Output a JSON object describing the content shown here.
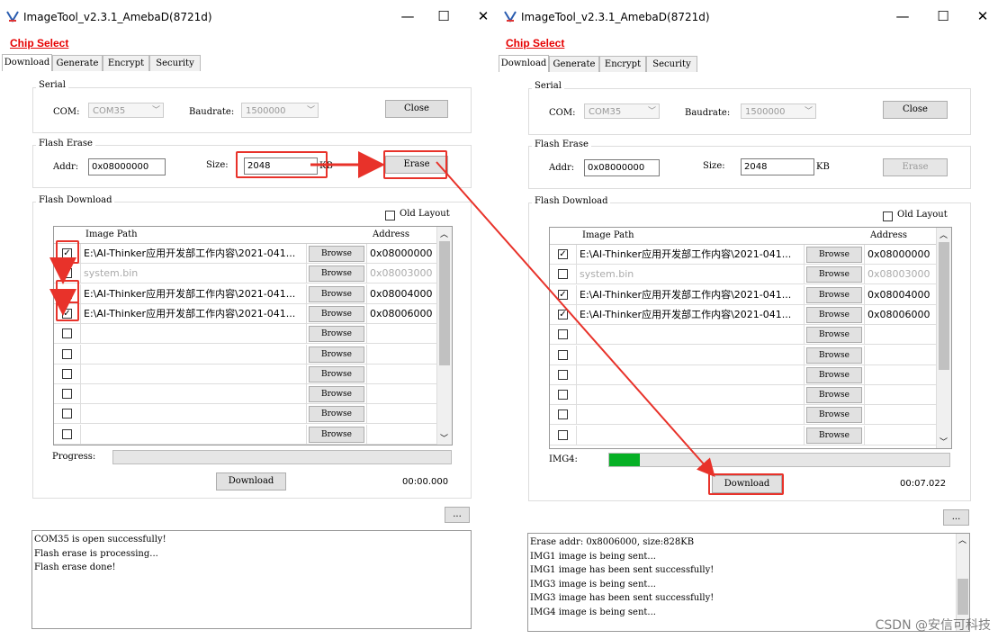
{
  "window_left": {
    "title": "ImageTool_v2.3.1_AmebaD(8721d)",
    "chip_select": "Chip Select",
    "tabs": [
      "Download",
      "Generate",
      "Encrypt",
      "Security"
    ],
    "serial": {
      "group": "Serial",
      "com_label": "COM:",
      "com_value": "COM35",
      "baud_label": "Baudrate:",
      "baud_value": "1500000",
      "button": "Close"
    },
    "flash_erase": {
      "group": "Flash Erase",
      "addr_label": "Addr:",
      "addr_value": "0x08000000",
      "size_label": "Size:",
      "size_value": "2048",
      "size_unit": "KB",
      "button": "Erase"
    },
    "flash_download": {
      "group": "Flash Download",
      "old_layout": "Old Layout",
      "col_path": "Image Path",
      "col_addr": "Address",
      "browse": "Browse",
      "rows": [
        {
          "checked": true,
          "path": "E:\\AI-Thinker应用开发部工作内容\\2021-041...",
          "address": "0x08000000",
          "dim": false
        },
        {
          "checked": false,
          "path": "system.bin",
          "address": "0x08003000",
          "dim": true
        },
        {
          "checked": true,
          "path": "E:\\AI-Thinker应用开发部工作内容\\2021-041...",
          "address": "0x08004000",
          "dim": false
        },
        {
          "checked": true,
          "path": "E:\\AI-Thinker应用开发部工作内容\\2021-041...",
          "address": "0x08006000",
          "dim": false
        },
        {
          "checked": false,
          "path": "",
          "address": "",
          "dim": false
        },
        {
          "checked": false,
          "path": "",
          "address": "",
          "dim": false
        },
        {
          "checked": false,
          "path": "",
          "address": "",
          "dim": false
        },
        {
          "checked": false,
          "path": "",
          "address": "",
          "dim": false
        },
        {
          "checked": false,
          "path": "",
          "address": "",
          "dim": false
        },
        {
          "checked": false,
          "path": "",
          "address": "",
          "dim": false
        }
      ],
      "progress_label": "Progress:",
      "progress_fraction": 0,
      "download": "Download",
      "timer": "00:00.000"
    },
    "more_button": "...",
    "log": [
      "COM35 is open successfully!",
      "Flash erase is processing...",
      "Flash erase done!"
    ]
  },
  "window_right": {
    "title": "ImageTool_v2.3.1_AmebaD(8721d)",
    "chip_select": "Chip Select",
    "tabs": [
      "Download",
      "Generate",
      "Encrypt",
      "Security"
    ],
    "serial": {
      "group": "Serial",
      "com_label": "COM:",
      "com_value": "COM35",
      "baud_label": "Baudrate:",
      "baud_value": "1500000",
      "button": "Close"
    },
    "flash_erase": {
      "group": "Flash Erase",
      "addr_label": "Addr:",
      "addr_value": "0x08000000",
      "size_label": "Size:",
      "size_value": "2048",
      "size_unit": "KB",
      "button": "Erase"
    },
    "flash_download": {
      "group": "Flash Download",
      "old_layout": "Old Layout",
      "col_path": "Image Path",
      "col_addr": "Address",
      "browse": "Browse",
      "rows": [
        {
          "checked": true,
          "path": "E:\\AI-Thinker应用开发部工作内容\\2021-041...",
          "address": "0x08000000",
          "dim": false
        },
        {
          "checked": false,
          "path": "system.bin",
          "address": "0x08003000",
          "dim": true
        },
        {
          "checked": true,
          "path": "E:\\AI-Thinker应用开发部工作内容\\2021-041...",
          "address": "0x08004000",
          "dim": false
        },
        {
          "checked": true,
          "path": "E:\\AI-Thinker应用开发部工作内容\\2021-041...",
          "address": "0x08006000",
          "dim": false
        },
        {
          "checked": false,
          "path": "",
          "address": "",
          "dim": false
        },
        {
          "checked": false,
          "path": "",
          "address": "",
          "dim": false
        },
        {
          "checked": false,
          "path": "",
          "address": "",
          "dim": false
        },
        {
          "checked": false,
          "path": "",
          "address": "",
          "dim": false
        },
        {
          "checked": false,
          "path": "",
          "address": "",
          "dim": false
        },
        {
          "checked": false,
          "path": "",
          "address": "",
          "dim": false
        }
      ],
      "progress_label": "IMG4:",
      "progress_fraction": 0.09,
      "download": "Download",
      "timer": "00:07.022"
    },
    "more_button": "...",
    "log": [
      "Erase addr: 0x8006000, size:828KB",
      "IMG1 image is being sent...",
      "IMG1 image has been sent successfully!",
      "IMG3 image is being sent...",
      "IMG3 image has been sent successfully!",
      "IMG4 image is being sent..."
    ]
  },
  "window_controls": {
    "minimize": "—",
    "maximize": "☐",
    "close": "✕"
  },
  "watermark": "CSDN @安信可科技",
  "annotation_color": "#e8322a"
}
